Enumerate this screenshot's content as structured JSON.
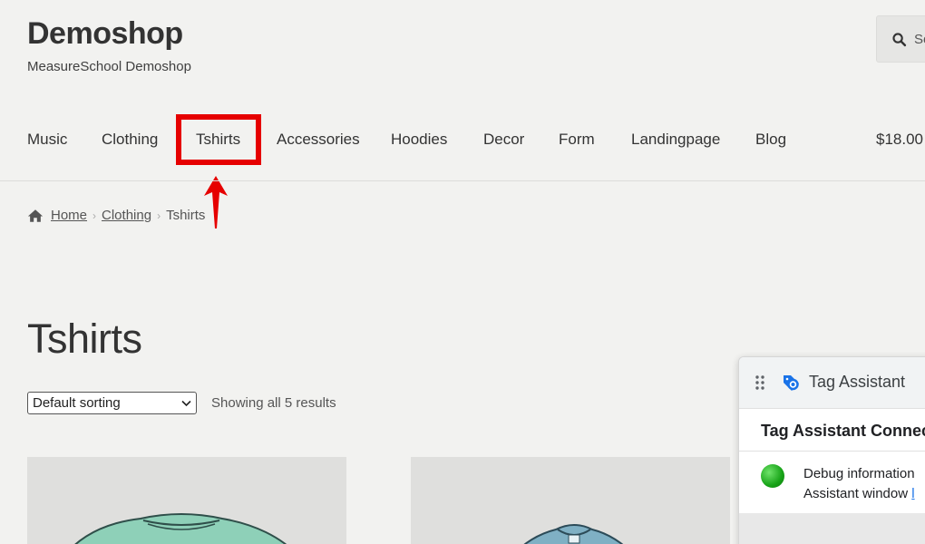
{
  "site": {
    "title": "Demoshop",
    "tagline": "MeasureSchool Demoshop"
  },
  "search": {
    "icon": "search-icon",
    "text_fragment": "Se"
  },
  "nav": {
    "items": [
      {
        "label": "Music"
      },
      {
        "label": "Clothing"
      },
      {
        "label": "Tshirts",
        "highlighted": true
      },
      {
        "label": "Accessories"
      },
      {
        "label": "Hoodies"
      },
      {
        "label": "Decor"
      },
      {
        "label": "Form"
      },
      {
        "label": "Landingpage"
      },
      {
        "label": "Blog"
      }
    ],
    "cart_total": "$18.00"
  },
  "annotation": {
    "highlight_color": "#e60000",
    "arrow_color": "#e60000"
  },
  "breadcrumb": {
    "home_icon": "home-icon",
    "items": [
      "Home",
      "Clothing",
      "Tshirts"
    ]
  },
  "page": {
    "title": "Tshirts"
  },
  "sorting": {
    "selected": "Default sorting",
    "result_count": "Showing all 5 results"
  },
  "products": [
    {
      "image": "tshirt-green"
    },
    {
      "image": "tshirt-blue"
    }
  ],
  "tag_assistant": {
    "title": "Tag Assistant",
    "connected_title": "Tag Assistant Connec",
    "line1": "Debug information",
    "line2": "Assistant window",
    "line2_link": "l",
    "status_color": "#17a317"
  }
}
